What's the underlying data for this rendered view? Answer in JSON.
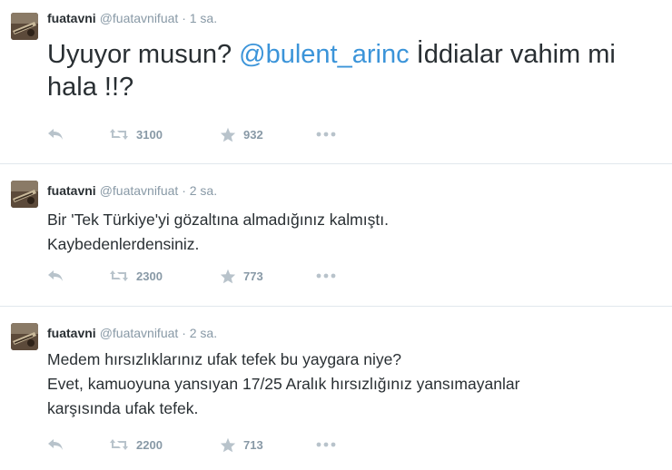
{
  "tweets": [
    {
      "name": "fuatavni",
      "handle": "@fuatavnifuat",
      "separator": "·",
      "time": "1 sa.",
      "text_before_mention": "Uyuyor musun? ",
      "mention": "@bulent_arinc",
      "text_after_mention": " İddialar vahim mi hala !!?",
      "retweets": "3100",
      "favorites": "932"
    },
    {
      "name": "fuatavni",
      "handle": "@fuatavnifuat",
      "separator": "·",
      "time": "2 sa.",
      "lines": [
        "Bir 'Tek Türkiye'yi gözaltına almadığınız kalmıştı.",
        "Kaybedenlerdensiniz."
      ],
      "retweets": "2300",
      "favorites": "773"
    },
    {
      "name": "fuatavni",
      "handle": "@fuatavnifuat",
      "separator": "·",
      "time": "2 sa.",
      "lines": [
        "Medem hırsızlıklarınız ufak tefek bu yaygara niye?",
        "Evet, kamuoyuna yansıyan 17/25 Aralık hırsızlığınız yansımayanlar",
        "karşısında ufak tefek."
      ],
      "retweets": "2200",
      "favorites": "713"
    }
  ],
  "icons": {
    "reply": "reply-icon",
    "retweet": "retweet-icon",
    "favorite": "star-icon",
    "more": "more-icon"
  },
  "colors": {
    "text": "#292f33",
    "muted": "#8899a6",
    "link": "#3b94d9",
    "action_icon": "#b8c3cb",
    "divider": "#e1e8ed"
  }
}
